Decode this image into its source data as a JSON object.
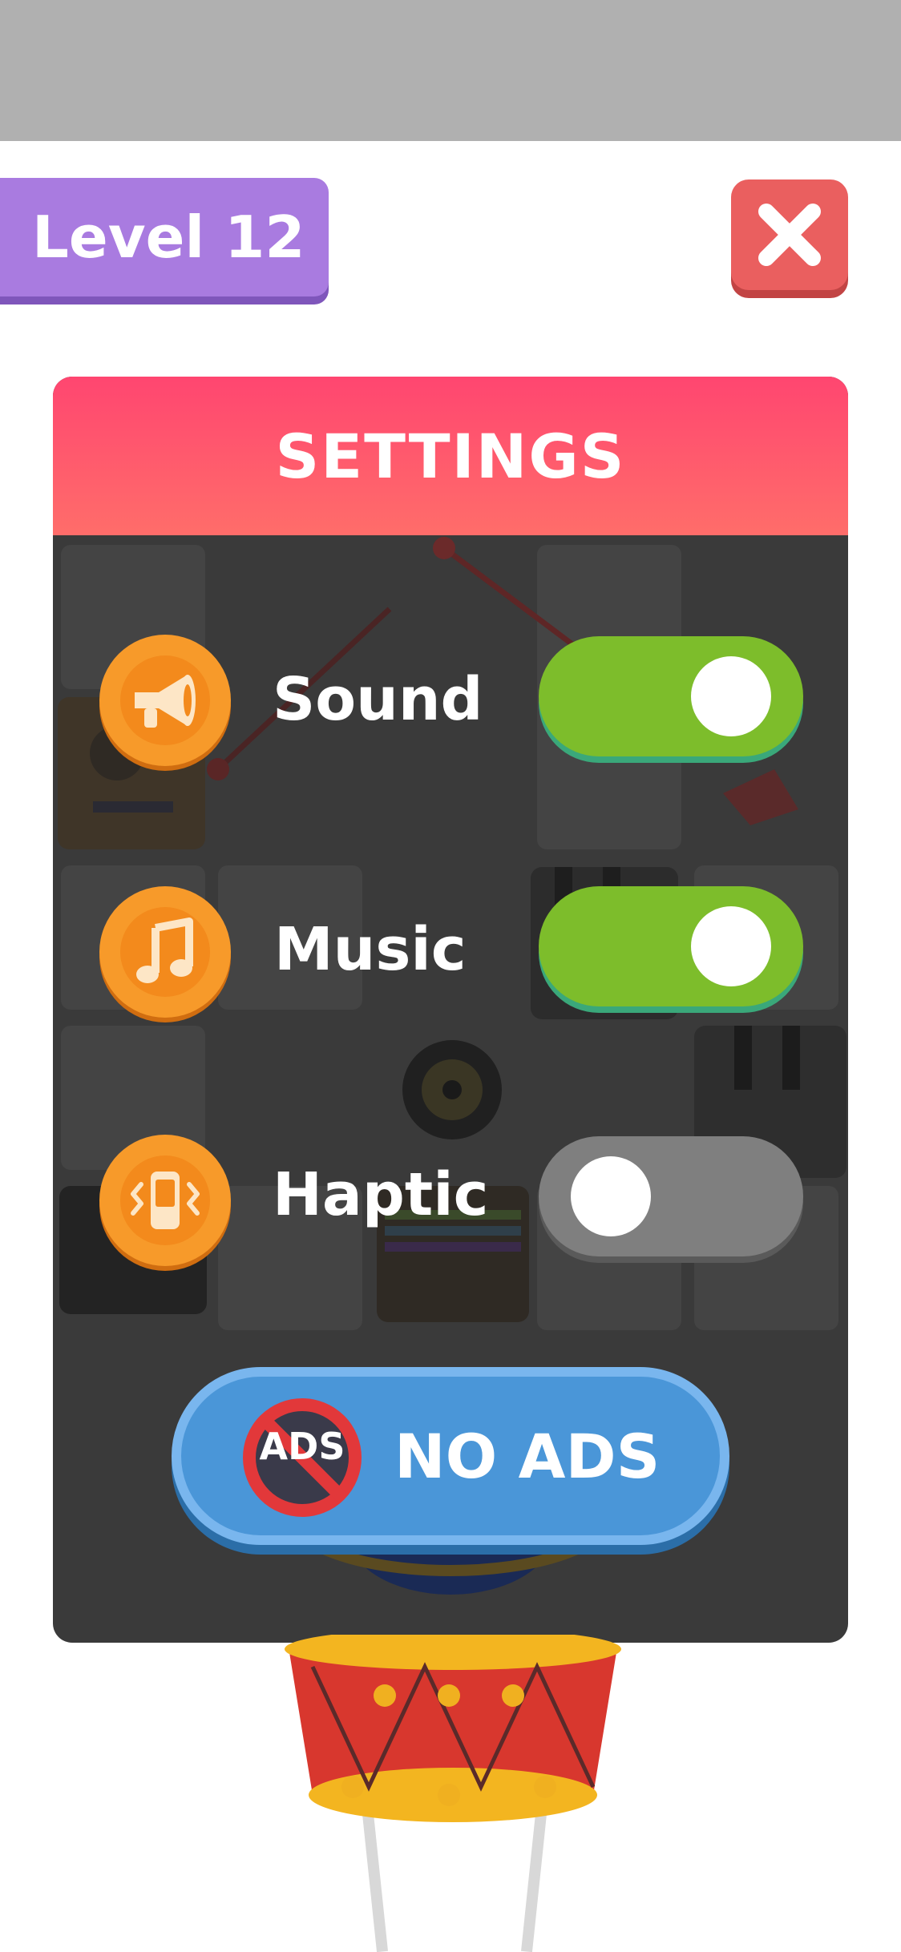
{
  "level": {
    "label": "Level 12"
  },
  "settings": {
    "title": "SETTINGS",
    "rows": [
      {
        "label": "Sound",
        "icon": "megaphone-icon",
        "enabled": true
      },
      {
        "label": "Music",
        "icon": "music-note-icon",
        "enabled": true
      },
      {
        "label": "Haptic",
        "icon": "vibrate-phone-icon",
        "enabled": false
      }
    ],
    "no_ads": {
      "label": "NO ADS",
      "icon_text": "ADS"
    }
  },
  "colors": {
    "header": "#ff5a6e",
    "toggle_on": "#7dbd2b",
    "toggle_off": "#7f7f7f",
    "close": "#ea5f5f",
    "level": "#a97be0",
    "no_ads": "#4a96d8"
  }
}
